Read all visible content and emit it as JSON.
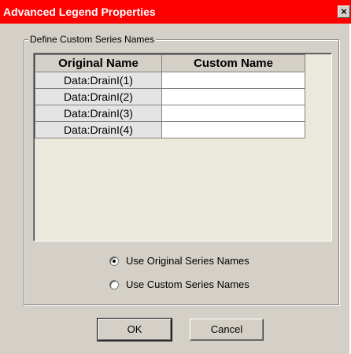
{
  "window": {
    "title": "Advanced Legend Properties",
    "close_label": "×"
  },
  "group": {
    "label": "Define Custom Series Names"
  },
  "table": {
    "columns": [
      "Original Name",
      "Custom Name"
    ],
    "rows": [
      {
        "original": "Data:DrainI(1)",
        "custom": ""
      },
      {
        "original": "Data:DrainI(2)",
        "custom": ""
      },
      {
        "original": "Data:DrainI(3)",
        "custom": ""
      },
      {
        "original": "Data:DrainI(4)",
        "custom": ""
      }
    ]
  },
  "options": {
    "use_original": {
      "label": "Use Original Series Names",
      "checked": true
    },
    "use_custom": {
      "label": "Use Custom Series Names",
      "checked": false
    }
  },
  "buttons": {
    "ok": "OK",
    "cancel": "Cancel"
  },
  "colors": {
    "titlebar": "#ff0000",
    "dialog_face": "#d4d0c8",
    "grid_background": "#ebe8dc"
  }
}
